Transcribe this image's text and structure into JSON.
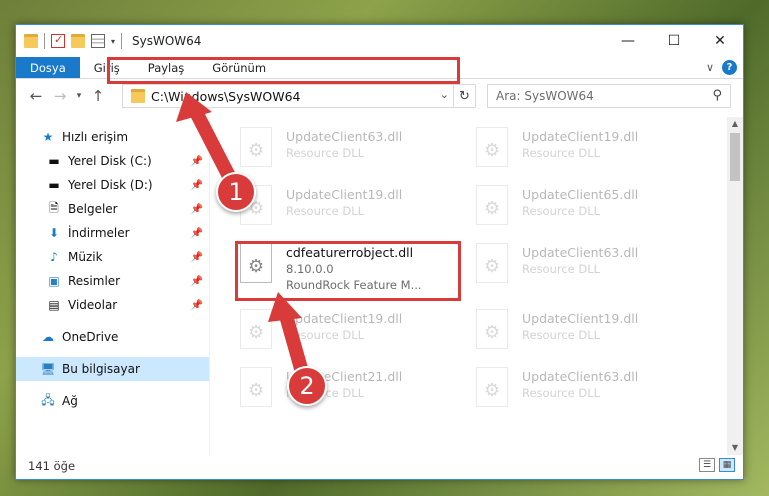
{
  "window": {
    "title": "SysWOW64",
    "controls": {
      "minimize": "—",
      "maximize": "☐",
      "close": "✕"
    }
  },
  "ribbon": {
    "tabs": [
      "Dosya",
      "Giriş",
      "Paylaş",
      "Görünüm"
    ],
    "expand_glyph": "∨",
    "help_glyph": "?"
  },
  "address": {
    "path": "C:\\Windows\\SysWOW64",
    "search_placeholder": "Ara: SysWOW64"
  },
  "nav": {
    "quick_access": "Hızlı erişim",
    "pinned": [
      {
        "label": "Yerel Disk (C:)",
        "icon": "drive-icon"
      },
      {
        "label": "Yerel Disk (D:)",
        "icon": "drive-icon"
      },
      {
        "label": "Belgeler",
        "icon": "documents-icon"
      },
      {
        "label": "İndirmeler",
        "icon": "downloads-icon"
      },
      {
        "label": "Müzik",
        "icon": "music-icon"
      },
      {
        "label": "Resimler",
        "icon": "pictures-icon"
      },
      {
        "label": "Videolar",
        "icon": "videos-icon"
      }
    ],
    "onedrive": "OneDrive",
    "this_pc": "Bu bilgisayar",
    "network": "Ağ"
  },
  "files": {
    "items": [
      {
        "name": "UpdateClient63.dll",
        "line1": "Resource DLL",
        "line2": ""
      },
      {
        "name": "UpdateClient19.dll",
        "line1": "Resource DLL",
        "line2": ""
      },
      {
        "name": "UpdateClient19.dll",
        "line1": "Resource DLL",
        "line2": ""
      },
      {
        "name": "UpdateClient65.dll",
        "line1": "Resource DLL",
        "line2": ""
      },
      {
        "name": "cdfeaturerrobject.dll",
        "line1": "8.10.0.0",
        "line2": "RoundRock Feature M..."
      },
      {
        "name": "UpdateClient63.dll",
        "line1": "Resource DLL",
        "line2": ""
      },
      {
        "name": "UpdateClient19.dll",
        "line1": "Resource DLL",
        "line2": ""
      },
      {
        "name": "UpdateClient19.dll",
        "line1": "Resource DLL",
        "line2": ""
      },
      {
        "name": "UpdateClient21.dll",
        "line1": "Resource DLL",
        "line2": ""
      },
      {
        "name": "UpdateClient63.dll",
        "line1": "Resource DLL",
        "line2": ""
      }
    ]
  },
  "status": {
    "count": "141 öğe"
  },
  "annotations": {
    "step1": "1",
    "step2": "2",
    "color": "#d93a3a"
  }
}
